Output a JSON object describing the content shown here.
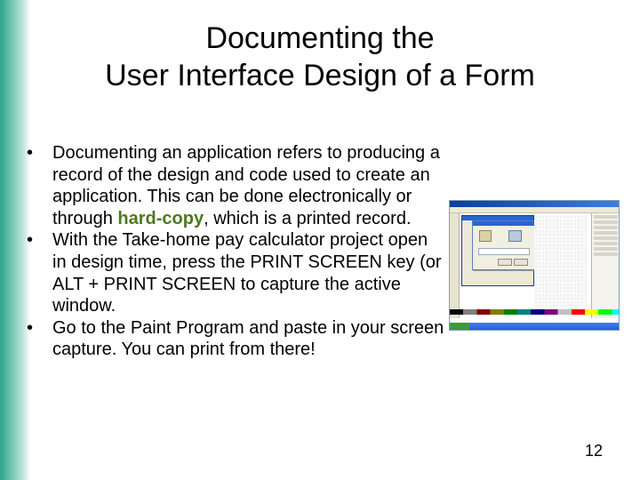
{
  "slide": {
    "title_line1": "Documenting the",
    "title_line2": "User Interface Design of a Form",
    "bullets": [
      {
        "text_before": "Documenting an application refers to producing a record of the design and code used to create an application. This can be done electronically or through ",
        "highlight": "hard-copy",
        "text_after": ", which is a printed record."
      },
      {
        "text": "With the Take-home pay calculator project open in design time, press the PRINT SCREEN key (or ALT + PRINT SCREEN to capture the active window."
      },
      {
        "text": "Go to the Paint Program and paste in your screen capture. You can print from there!"
      }
    ],
    "bullet_glyph": "•",
    "page_number": "12"
  },
  "colors": {
    "accent_band": "#2fa58d",
    "highlight_text": "#4d7a1e"
  }
}
